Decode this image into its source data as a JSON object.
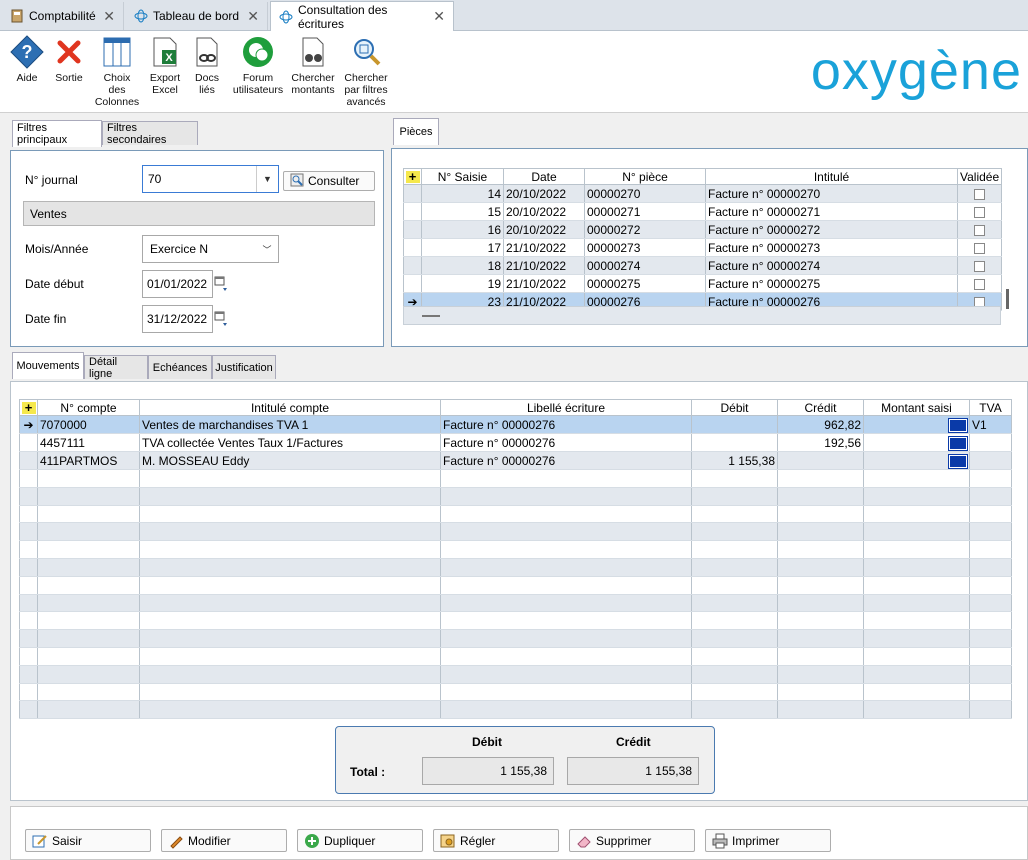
{
  "window_tabs": [
    {
      "label": "Comptabilité"
    },
    {
      "label": "Tableau de bord"
    },
    {
      "label": "Consultation des écritures"
    }
  ],
  "toolbar": {
    "aide": "Aide",
    "sortie": "Sortie",
    "choix_colonnes": [
      "Choix",
      "des",
      "Colonnes"
    ],
    "export_excel": [
      "Export",
      "Excel"
    ],
    "docs_lies": [
      "Docs",
      "liés"
    ],
    "forum": [
      "Forum",
      "utilisateurs"
    ],
    "chercher_montants": [
      "Chercher",
      "montants"
    ],
    "chercher_filtres": [
      "Chercher",
      "par filtres",
      "avancés"
    ],
    "logo": "oxygène"
  },
  "filters": {
    "tab_main": "Filtres principaux",
    "tab_secondary": "Filtres secondaires",
    "journal_label": "N° journal",
    "journal_value": "70",
    "consulter": "Consulter",
    "journal_name": "Ventes",
    "period_label": "Mois/Année",
    "period_value": "Exercice N",
    "start_label": "Date début",
    "start_value": "01/01/2022",
    "end_label": "Date fin",
    "end_value": "31/12/2022"
  },
  "pieces": {
    "tab": "Pièces",
    "columns": [
      "N° Saisie",
      "Date",
      "N° pièce",
      "Intitulé",
      "Validée"
    ],
    "rows": [
      {
        "saisie": "14",
        "date": "20/10/2022",
        "piece": "00000270",
        "intitule": "Facture n° 00000270"
      },
      {
        "saisie": "15",
        "date": "20/10/2022",
        "piece": "00000271",
        "intitule": "Facture n° 00000271"
      },
      {
        "saisie": "16",
        "date": "20/10/2022",
        "piece": "00000272",
        "intitule": "Facture n° 00000272"
      },
      {
        "saisie": "17",
        "date": "21/10/2022",
        "piece": "00000273",
        "intitule": "Facture n° 00000273"
      },
      {
        "saisie": "18",
        "date": "21/10/2022",
        "piece": "00000274",
        "intitule": "Facture n° 00000274"
      },
      {
        "saisie": "19",
        "date": "21/10/2022",
        "piece": "00000275",
        "intitule": "Facture n° 00000275"
      },
      {
        "saisie": "23",
        "date": "21/10/2022",
        "piece": "00000276",
        "intitule": "Facture n° 00000276"
      }
    ]
  },
  "movements": {
    "tabs": [
      "Mouvements",
      "Détail ligne",
      "Echéances",
      "Justification"
    ],
    "columns": [
      "N° compte",
      "Intitulé compte",
      "Libellé écriture",
      "Débit",
      "Crédit",
      "Montant saisi",
      "TVA"
    ],
    "rows": [
      {
        "compte": "7070000",
        "intitule": "Ventes de marchandises TVA 1",
        "libelle": "Facture n° 00000276",
        "debit": "",
        "credit": "962,82",
        "tva": "V1"
      },
      {
        "compte": "4457111",
        "intitule": "TVA collectée Ventes Taux 1/Factures",
        "libelle": "Facture n° 00000276",
        "debit": "",
        "credit": "192,56",
        "tva": ""
      },
      {
        "compte": "411PARTMOS",
        "intitule": "M. MOSSEAU Eddy",
        "libelle": "Facture n° 00000276",
        "debit": "1 155,38",
        "credit": "",
        "tva": ""
      }
    ]
  },
  "totals": {
    "debit_label": "Débit",
    "credit_label": "Crédit",
    "total_label": "Total :",
    "debit": "1 155,38",
    "credit": "1 155,38"
  },
  "actions": {
    "saisir": "Saisir",
    "modifier": "Modifier",
    "dupliquer": "Dupliquer",
    "regler": "Régler",
    "supprimer": "Supprimer",
    "imprimer": "Imprimer"
  }
}
